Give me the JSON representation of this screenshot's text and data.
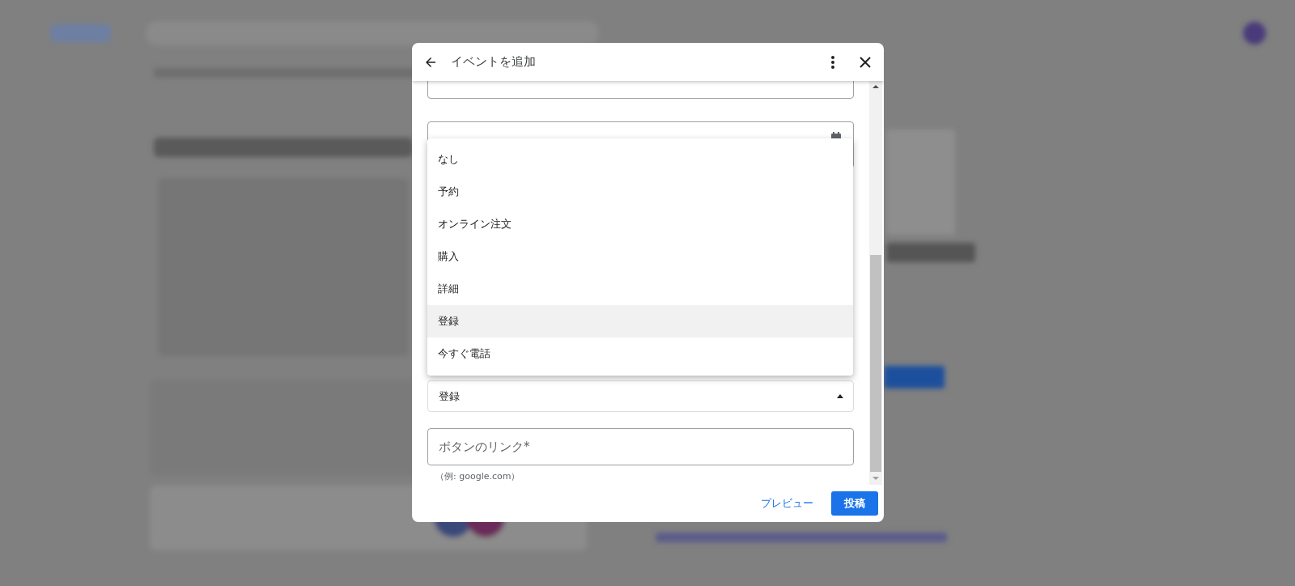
{
  "dialog": {
    "title": "イベントを追加",
    "menu": {
      "items": [
        {
          "label": "なし",
          "selected": false
        },
        {
          "label": "予約",
          "selected": false
        },
        {
          "label": "オンライン注文",
          "selected": false
        },
        {
          "label": "購入",
          "selected": false
        },
        {
          "label": "詳細",
          "selected": false
        },
        {
          "label": "登録",
          "selected": true
        },
        {
          "label": "今すぐ電話",
          "selected": false
        }
      ]
    },
    "select": {
      "value": "登録",
      "expanded": true
    },
    "link_field": {
      "placeholder": "ボタンのリンク*",
      "hint": "（例: google.com）"
    },
    "buttons": [
      {
        "label": "プレビュー",
        "kind": "text"
      },
      {
        "label": "投稿",
        "kind": "primary"
      }
    ]
  }
}
